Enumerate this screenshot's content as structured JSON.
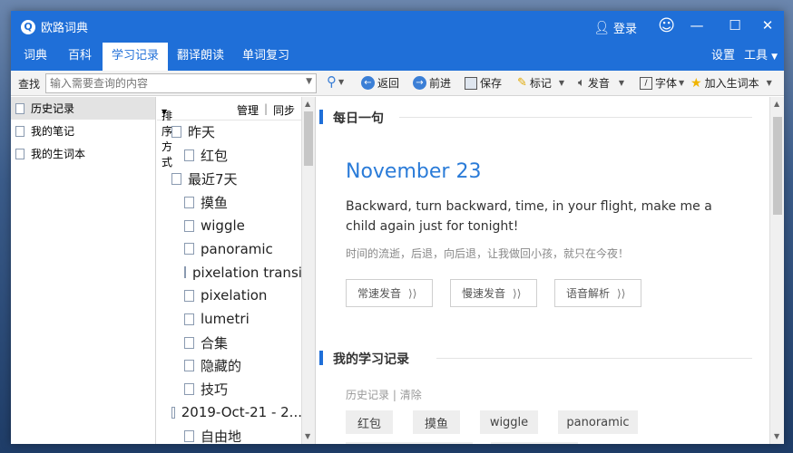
{
  "window": {
    "title": "欧路词典"
  },
  "titlebar": {
    "login_label": "登录",
    "app_icon": "Q"
  },
  "menu": {
    "tabs": [
      "词典",
      "百科",
      "学习记录",
      "翻译朗读",
      "单词复习"
    ],
    "active_tab": "学习记录",
    "settings_label": "设置",
    "tools_label": "工具"
  },
  "toolbar": {
    "find_label": "查找",
    "search_placeholder": "输入需要查询的内容",
    "back_label": "返回",
    "forward_label": "前进",
    "save_label": "保存",
    "mark_label": "标记",
    "speak_label": "发音",
    "font_label": "字体",
    "add_vocab_label": "加入生词本"
  },
  "leftnav": {
    "items": [
      "历史记录",
      "我的笔记",
      "我的生词本"
    ],
    "active": "历史记录"
  },
  "history": {
    "sort_label": "排序方式",
    "manage_label": "管理",
    "separator": "|",
    "sync_label": "同步",
    "rows": [
      {
        "text": "昨天",
        "level": 0
      },
      {
        "text": "红包",
        "level": 1
      },
      {
        "text": "最近7天",
        "level": 0
      },
      {
        "text": "摸鱼",
        "level": 1
      },
      {
        "text": "wiggle",
        "level": 1
      },
      {
        "text": "panoramic",
        "level": 1
      },
      {
        "text": "pixelation transit",
        "level": 1
      },
      {
        "text": "pixelation",
        "level": 1
      },
      {
        "text": "lumetri",
        "level": 1
      },
      {
        "text": "合集",
        "level": 1
      },
      {
        "text": "隐藏的",
        "level": 1
      },
      {
        "text": "技巧",
        "level": 1
      },
      {
        "text": "2019-Oct-21 - 2...",
        "level": 0
      },
      {
        "text": "自由地",
        "level": 1
      }
    ]
  },
  "daily": {
    "section_title": "每日一句",
    "date": "November 23",
    "english": "Backward, turn backward, time, in your flight, make me a child again just for tonight!",
    "chinese": "时间的流逝，后退，向后退，让我做回小孩，就只在今夜！",
    "buttons": [
      "常速发音",
      "慢速发音",
      "语音解析"
    ]
  },
  "study": {
    "section_title": "我的学习记录",
    "history_link": "历史记录",
    "separator": "|",
    "clear_link": "清除",
    "chips": [
      "红包",
      "摸鱼",
      "wiggle",
      "panoramic"
    ]
  },
  "colors": {
    "accent": "#1f6fd8",
    "date_blue": "#2a7bd8"
  }
}
